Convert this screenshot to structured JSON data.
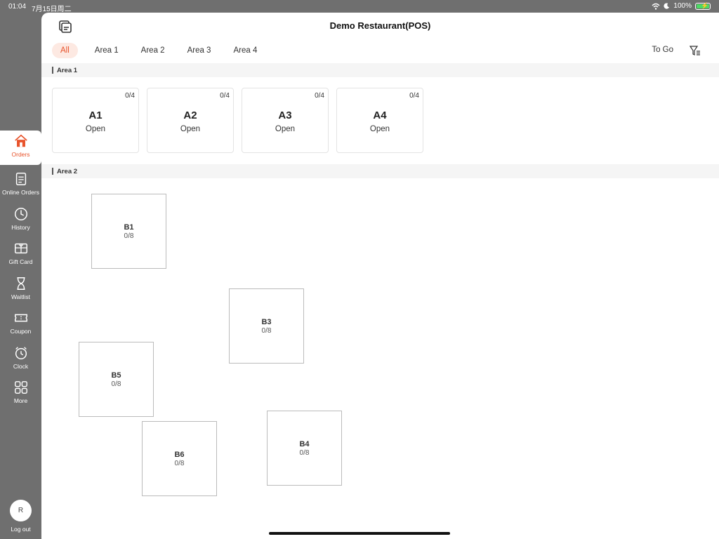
{
  "status_bar": {
    "time": "01:04",
    "date": "7月15日周二",
    "battery": "100%"
  },
  "sidebar": {
    "items": [
      {
        "label": "Orders",
        "icon": "home-icon",
        "active": true
      },
      {
        "label": "Online Orders",
        "icon": "document-icon"
      },
      {
        "label": "History",
        "icon": "clock-icon"
      },
      {
        "label": "Gift Card",
        "icon": "gift-card-icon"
      },
      {
        "label": "Waitlist",
        "icon": "hourglass-icon"
      },
      {
        "label": "Coupon",
        "icon": "ticket-icon"
      },
      {
        "label": "Clock",
        "icon": "alarm-clock-icon"
      },
      {
        "label": "More",
        "icon": "grid-icon"
      }
    ],
    "avatar_initial": "R",
    "logout_label": "Log out"
  },
  "header": {
    "title": "Demo Restaurant(POS)"
  },
  "tabs": {
    "items": [
      "All",
      "Area 1",
      "Area 2",
      "Area 3",
      "Area 4"
    ],
    "active": "All",
    "to_go": "To Go"
  },
  "area1": {
    "title": "Area 1",
    "tables": [
      {
        "name": "A1",
        "status": "Open",
        "capacity": "0/4"
      },
      {
        "name": "A2",
        "status": "Open",
        "capacity": "0/4"
      },
      {
        "name": "A3",
        "status": "Open",
        "capacity": "0/4"
      },
      {
        "name": "A4",
        "status": "Open",
        "capacity": "0/4"
      }
    ]
  },
  "area2": {
    "title": "Area 2",
    "tables": [
      {
        "name": "B1",
        "capacity": "0/8"
      },
      {
        "name": "B3",
        "capacity": "0/8"
      },
      {
        "name": "B5",
        "capacity": "0/8"
      },
      {
        "name": "B6",
        "capacity": "0/8"
      },
      {
        "name": "B4",
        "capacity": "0/8"
      }
    ]
  },
  "colors": {
    "accent": "#e8532b",
    "sidebar_bg": "#6f6f6f"
  }
}
